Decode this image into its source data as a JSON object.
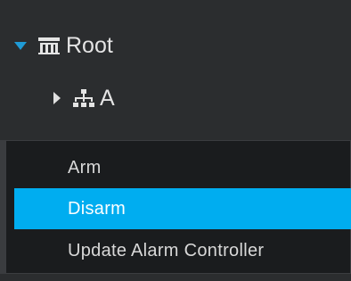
{
  "tree": {
    "root": {
      "label": "Root",
      "expanded": true,
      "icon": "building-icon"
    },
    "child": {
      "label": "A",
      "expanded": false,
      "icon": "network-icon"
    }
  },
  "context_menu": {
    "items": [
      {
        "label": "Arm"
      },
      {
        "label": "Disarm",
        "highlighted": true
      },
      {
        "label": "Update Alarm Controller"
      }
    ]
  },
  "colors": {
    "background": "#2b2d2f",
    "menu_background": "#1a1c1e",
    "highlight": "#00adf0",
    "expand_caret": "#1f9bd6"
  }
}
